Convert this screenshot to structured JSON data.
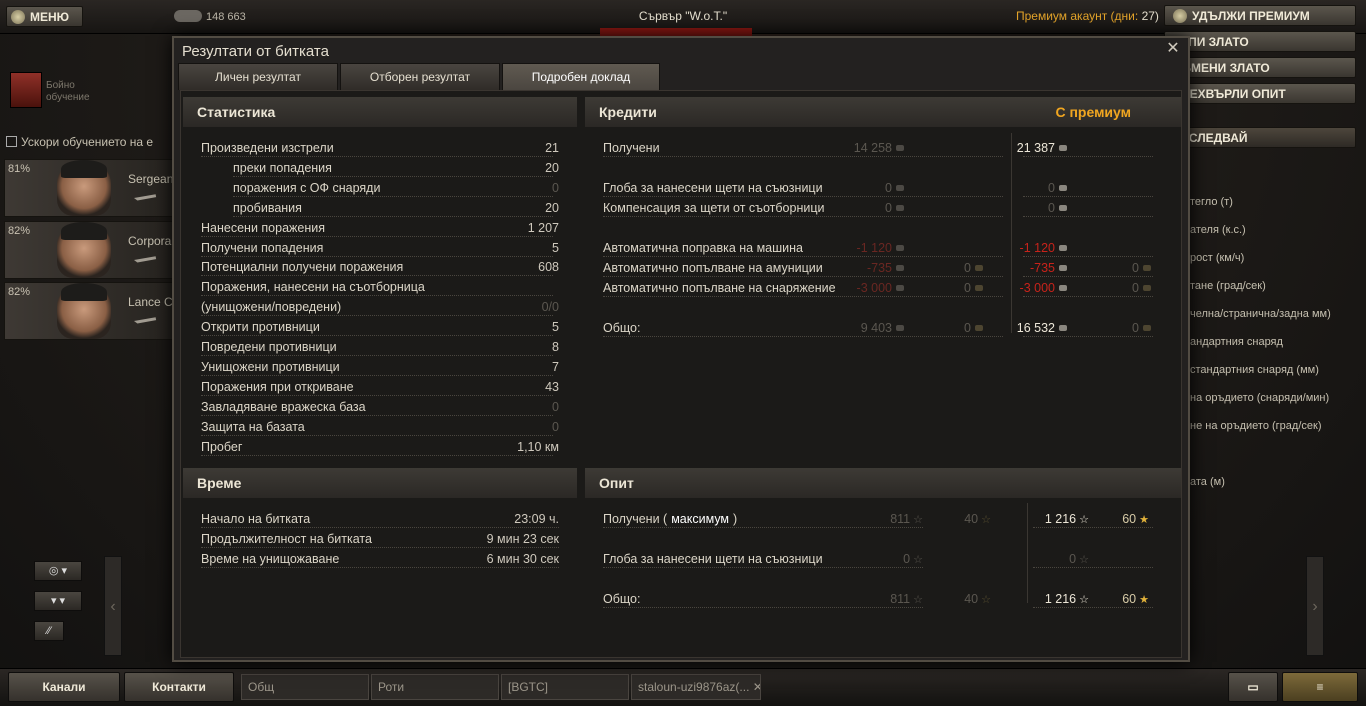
{
  "top": {
    "menu": "МЕНЮ",
    "credits": "148 663",
    "server": "Сървър \"W.o.T.\"",
    "premium_label": "Премиум акаунт (дни:",
    "premium_days": "27)",
    "extend": "УДЪЛЖИ ПРЕМИУМ",
    "buy_gold": "КУПИ ЗЛАТО",
    "exchange_gold": "ОБМЕНИ ЗЛАТО",
    "transfer_xp": "ПРЕХВЪРЛИ ОПИТ",
    "research": "ИЗСЛЕДВАЙ"
  },
  "left": {
    "training": "Бойно\nобучение",
    "accelerate": "Ускори обучението на е",
    "crew": [
      {
        "pct": "81%",
        "rank": "Sergeant"
      },
      {
        "pct": "82%",
        "rank": "Corporal"
      },
      {
        "pct": "82%",
        "rank": "Lance Co"
      }
    ]
  },
  "right_stats": [
    "тегло (т)",
    "ателя (к.с.)",
    "рост (км/ч)",
    "тане (град/сек)",
    "челна/странична/задна мм)",
    "андартния снаряд",
    "стандартния снаряд (мм)",
    "на оръдието (снаряди/мин)",
    "не на оръдието (град/сек)",
    "ата (м)"
  ],
  "dialog": {
    "title": "Резултати от битката",
    "close": "✕",
    "tabs": [
      "Личен резултат",
      "Отборен резултат",
      "Подробен доклад"
    ],
    "stats": {
      "header": "Статистика",
      "rows": [
        {
          "label": "Произведени изстрели",
          "value": "21",
          "indent": false,
          "dim": false
        },
        {
          "label": "преки попадения",
          "value": "20",
          "indent": true,
          "dim": false
        },
        {
          "label": "поражения с ОФ снаряди",
          "value": "0",
          "indent": true,
          "dim": true
        },
        {
          "label": "пробивания",
          "value": "20",
          "indent": true,
          "dim": false
        },
        {
          "label": "Нанесени поражения",
          "value": "1 207",
          "indent": false,
          "dim": false
        },
        {
          "label": "Получени попадения",
          "value": "5",
          "indent": false,
          "dim": false
        },
        {
          "label": "Потенциални получени поражения",
          "value": "608",
          "indent": false,
          "dim": false
        },
        {
          "label": "Поражения, нанесени на съотборница",
          "value": "",
          "indent": false,
          "dim": false
        },
        {
          "label": "(унищожени/повредени)",
          "value": "0/0",
          "indent": false,
          "dim": true
        },
        {
          "label": "Открити противници",
          "value": "5",
          "indent": false,
          "dim": false
        },
        {
          "label": "Повредени противници",
          "value": "8",
          "indent": false,
          "dim": false
        },
        {
          "label": "Унищожени противници",
          "value": "7",
          "indent": false,
          "dim": false
        },
        {
          "label": "Поражения при откриване",
          "value": "43",
          "indent": false,
          "dim": false
        },
        {
          "label": "Завладяване вражеска база",
          "value": "0",
          "indent": false,
          "dim": true
        },
        {
          "label": "Защита на базата",
          "value": "0",
          "indent": false,
          "dim": true
        },
        {
          "label": "Пробег",
          "value": "1,10 км",
          "indent": false,
          "dim": false
        }
      ]
    },
    "time": {
      "header": "Време",
      "rows": [
        {
          "label": "Начало на битката",
          "value": "23:09 ч."
        },
        {
          "label": "Продължителност на битката",
          "value": "9 мин 23 сек"
        },
        {
          "label": "Време на унищожаване",
          "value": "6 мин 30 сек"
        }
      ]
    },
    "credits": {
      "header": "Кредити",
      "premium": "С премиум",
      "rows": [
        {
          "label": "Получени",
          "base": "14 258",
          "base_gold": "",
          "prem": "21 387",
          "prem_gold": "",
          "neg": false,
          "gap": 0
        },
        {
          "label": "Глоба за нанесени щети на съюзници",
          "base": "0",
          "base_gold": "",
          "prem": "0",
          "prem_gold": "",
          "neg": false,
          "gap": 1
        },
        {
          "label": "Компенсация за щети от съотборници",
          "base": "0",
          "base_gold": "",
          "prem": "0",
          "prem_gold": "",
          "neg": false,
          "gap": 1
        },
        {
          "label": "Автоматична поправка на машина",
          "base": "-1 120",
          "base_gold": "",
          "prem": "-1 120",
          "prem_gold": "",
          "neg": true,
          "gap": 2
        },
        {
          "label": "Автоматично попълване на амуниции",
          "base": "-735",
          "base_gold": "0",
          "prem": "-735",
          "prem_gold": "0",
          "neg": true,
          "gap": 2
        },
        {
          "label": "Автоматично попълване на снаряжение",
          "base": "-3 000",
          "base_gold": "0",
          "prem": "-3 000",
          "prem_gold": "0",
          "neg": true,
          "gap": 2
        },
        {
          "label": "Общо:",
          "base": "9 403",
          "base_gold": "0",
          "prem": "16 532",
          "prem_gold": "0",
          "neg": false,
          "gap": 3
        }
      ]
    },
    "xp": {
      "header": "Опит",
      "rows": [
        {
          "label": "Получени (",
          "emph": "максимум",
          "close": ")",
          "base": "811",
          "base_free": "40",
          "prem": "1 216",
          "prem_free": "60"
        },
        {
          "label": "Глоба за нанесени щети на съюзници",
          "emph": "",
          "close": "",
          "base": "0",
          "base_free": "",
          "prem": "0",
          "prem_free": ""
        },
        {
          "label": "Общо:",
          "emph": "",
          "close": "",
          "base": "811",
          "base_free": "40",
          "prem": "1 216",
          "prem_free": "60"
        }
      ]
    }
  },
  "bottom": {
    "channels": "Канали",
    "contacts": "Контакти",
    "chan1": "Общ",
    "chan2": "Роти",
    "chan3": "[BGTC]",
    "chan4": "staloun-uzi9876az(..."
  }
}
